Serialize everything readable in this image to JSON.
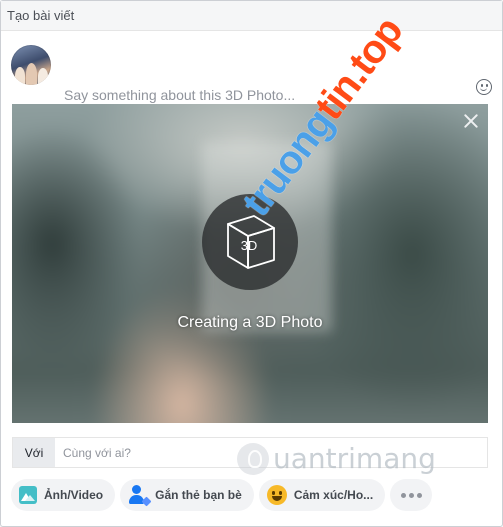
{
  "header": {
    "title": "Tạo bài viết"
  },
  "composer": {
    "placeholder": "Say something about this 3D Photo..."
  },
  "photo": {
    "cube_label": "3D",
    "status": "Creating a 3D Photo"
  },
  "with": {
    "label": "Với",
    "placeholder": "Cùng với ai?"
  },
  "actions": [
    {
      "label": "Ảnh/Video",
      "icon": "photo-video-icon"
    },
    {
      "label": "Gắn thẻ bạn bè",
      "icon": "tag-friends-icon"
    },
    {
      "label": "Cảm xúc/Ho...",
      "icon": "feeling-icon"
    }
  ],
  "watermarks": {
    "top_right": {
      "orange": "tin.top",
      "blue": "truong"
    },
    "bottom": "uantrimang"
  },
  "colors": {
    "header_bg": "#f5f6f7",
    "photo_icon": "#44bec7",
    "tag_icon": "#1877f2",
    "feeling_icon": "#f7b928",
    "watermark_orange": "#ff4b16",
    "watermark_blue": "#4ba0e8"
  }
}
